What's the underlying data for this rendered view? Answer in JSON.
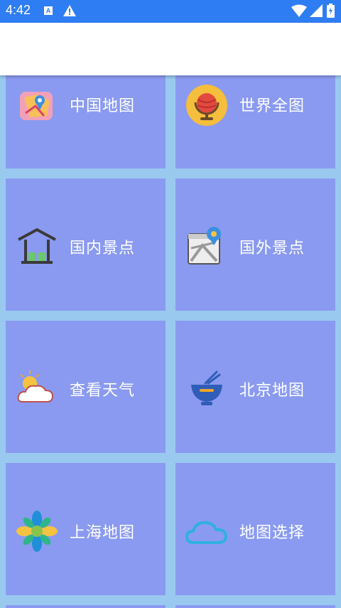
{
  "status_bar": {
    "time": "4:42",
    "icons": [
      "accessibility-a-icon",
      "warning-icon",
      "wifi-icon",
      "cell-signal-icon",
      "battery-icon"
    ],
    "accessibility_badge": "A"
  },
  "colors": {
    "status_bar_bg": "#2f7df2",
    "app_bar_bg": "#ffffff",
    "grid_bg": "#9ac9f0",
    "tile_bg": "#8a9af0",
    "tile_text": "#ffffff"
  },
  "menu": {
    "items": [
      {
        "label": "中国地图",
        "icon": "china-map-icon"
      },
      {
        "label": "世界全图",
        "icon": "globe-icon"
      },
      {
        "label": "国内景点",
        "icon": "pavilion-icon"
      },
      {
        "label": "国外景点",
        "icon": "map-pin-icon"
      },
      {
        "label": "查看天气",
        "icon": "weather-icon"
      },
      {
        "label": "北京地图",
        "icon": "bowl-icon"
      },
      {
        "label": "上海地图",
        "icon": "flower-icon"
      },
      {
        "label": "地图选择",
        "icon": "cloud-icon"
      }
    ]
  }
}
